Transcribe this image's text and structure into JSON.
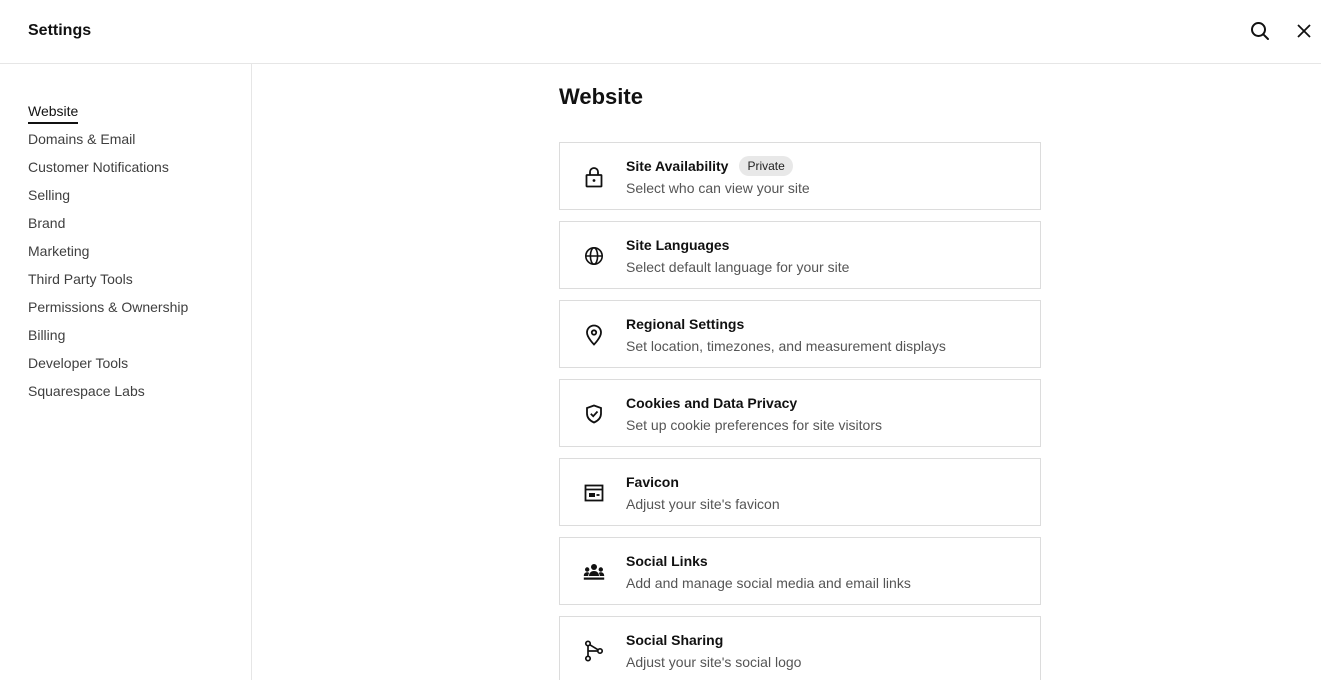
{
  "header": {
    "title": "Settings",
    "search_icon": "search-icon",
    "close_icon": "close-icon"
  },
  "sidebar": {
    "items": [
      {
        "label": "Website",
        "active": true
      },
      {
        "label": "Domains & Email"
      },
      {
        "label": "Customer Notifications"
      },
      {
        "label": "Selling"
      },
      {
        "label": "Brand"
      },
      {
        "label": "Marketing"
      },
      {
        "label": "Third Party Tools"
      },
      {
        "label": "Permissions & Ownership"
      },
      {
        "label": "Billing"
      },
      {
        "label": "Developer Tools"
      },
      {
        "label": "Squarespace Labs"
      }
    ]
  },
  "main": {
    "title": "Website",
    "cards": [
      {
        "icon": "lock-icon",
        "title": "Site Availability",
        "badge": "Private",
        "desc": "Select who can view your site"
      },
      {
        "icon": "globe-icon",
        "title": "Site Languages",
        "desc": "Select default language for your site"
      },
      {
        "icon": "map-pin-icon",
        "title": "Regional Settings",
        "desc": "Set location, timezones, and measurement displays"
      },
      {
        "icon": "shield-check-icon",
        "title": "Cookies and Data Privacy",
        "desc": "Set up cookie preferences for site visitors"
      },
      {
        "icon": "favicon-icon",
        "title": "Favicon",
        "desc": "Adjust your site's favicon"
      },
      {
        "icon": "people-icon",
        "title": "Social Links",
        "desc": "Add and manage social media and email links"
      },
      {
        "icon": "share-icon",
        "title": "Social Sharing",
        "desc": "Adjust your site's social logo"
      }
    ]
  }
}
